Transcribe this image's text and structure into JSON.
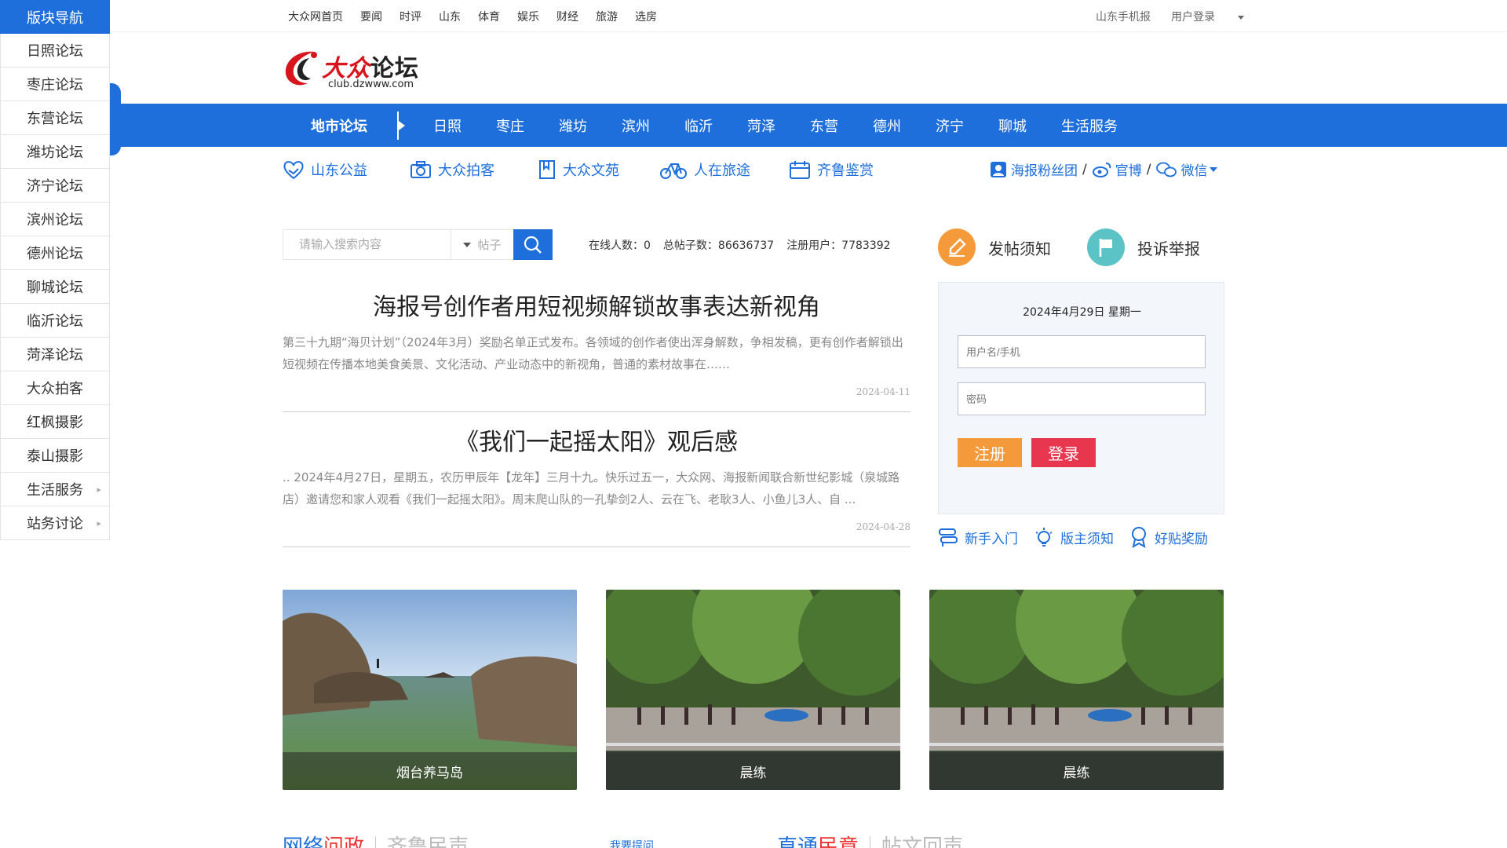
{
  "sidebar": {
    "title": "版块导航",
    "items": [
      {
        "label": "日照论坛",
        "has_arrow": false
      },
      {
        "label": "枣庄论坛",
        "has_arrow": false
      },
      {
        "label": "东营论坛",
        "has_arrow": false
      },
      {
        "label": "潍坊论坛",
        "has_arrow": false
      },
      {
        "label": "济宁论坛",
        "has_arrow": false
      },
      {
        "label": "滨州论坛",
        "has_arrow": false
      },
      {
        "label": "德州论坛",
        "has_arrow": false
      },
      {
        "label": "聊城论坛",
        "has_arrow": false
      },
      {
        "label": "临沂论坛",
        "has_arrow": false
      },
      {
        "label": "菏泽论坛",
        "has_arrow": false
      },
      {
        "label": "大众拍客",
        "has_arrow": false
      },
      {
        "label": "红枫摄影",
        "has_arrow": false
      },
      {
        "label": "泰山摄影",
        "has_arrow": false
      },
      {
        "label": "生活服务",
        "has_arrow": true
      },
      {
        "label": "站务讨论",
        "has_arrow": true
      }
    ]
  },
  "topbar": {
    "links": [
      "大众网首页",
      "要闻",
      "时评",
      "山东",
      "体育",
      "娱乐",
      "财经",
      "旅游",
      "选房"
    ],
    "mobile": "山东手机报",
    "login": "用户登录"
  },
  "logo": {
    "brand_red": "大众",
    "brand_black": "论坛",
    "url": "club.dzwww.com"
  },
  "bluenav": {
    "main": "地市论坛",
    "cities": [
      "日照",
      "枣庄",
      "潍坊",
      "滨州",
      "临沂",
      "菏泽",
      "东营",
      "德州",
      "济宁",
      "聊城",
      "生活服务"
    ]
  },
  "quick": {
    "links": [
      "山东公益",
      "大众拍客",
      "大众文苑",
      "人在旅途",
      "齐鲁鉴赏"
    ],
    "haibao": "海报粉丝团",
    "weibo": "官博",
    "weixin": "微信"
  },
  "search": {
    "placeholder": "请输入搜索内容",
    "type": "帖子"
  },
  "stats": {
    "online": "在线人数：0",
    "posts": "总帖子数：86636737",
    "users": "注册用户：7783392"
  },
  "articles": [
    {
      "title": "海报号创作者用短视频解锁故事表达新视角",
      "summary": "第三十九期“海贝计划”（2024年3月）奖励名单正式发布。各领域的创作者使出浑身解数，争相发稿，更有创作者解锁出短视频在传播本地美食美景、文化活动、产业动态中的新视角，普通的素材故事在……",
      "date": "2024-04-11"
    },
    {
      "title": "《我们一起摇太阳》观后感",
      "summary": ".. 2024年4月27日，星期五，农历甲辰年【龙年】三月十九。快乐过五一，大众网、海报新闻联合新世纪影城（泉城路店）邀请您和家人观看《我们一起摇太阳》。周末爬山队的一孔挚剑2人、云在飞、老耿3人、小鱼儿3人、自 ...",
      "date": "2024-04-28"
    }
  ],
  "login_panel": {
    "post_rules": "发帖须知",
    "report": "投诉举报",
    "date": "2024年4月29日 星期一",
    "username_placeholder": "用户名/手机",
    "password_placeholder": "密码",
    "register": "注册",
    "login": "登录"
  },
  "help_links": [
    "新手入门",
    "版主须知",
    "好贴奖励"
  ],
  "photos": [
    {
      "caption": "烟台养马岛"
    },
    {
      "caption": "晨练"
    },
    {
      "caption": "晨练"
    }
  ],
  "bottom_tabs": {
    "left_a": "网络",
    "left_b": "问政",
    "left_c": "齐鲁民声",
    "left_more": "我要提问",
    "right_a": "直通",
    "right_b": "民意",
    "right_c": "帖文回声"
  },
  "colors": {
    "primary": "#1e6fdb",
    "orange": "#f59a3a",
    "red": "#e8364f",
    "teal": "#5bc3c6"
  }
}
